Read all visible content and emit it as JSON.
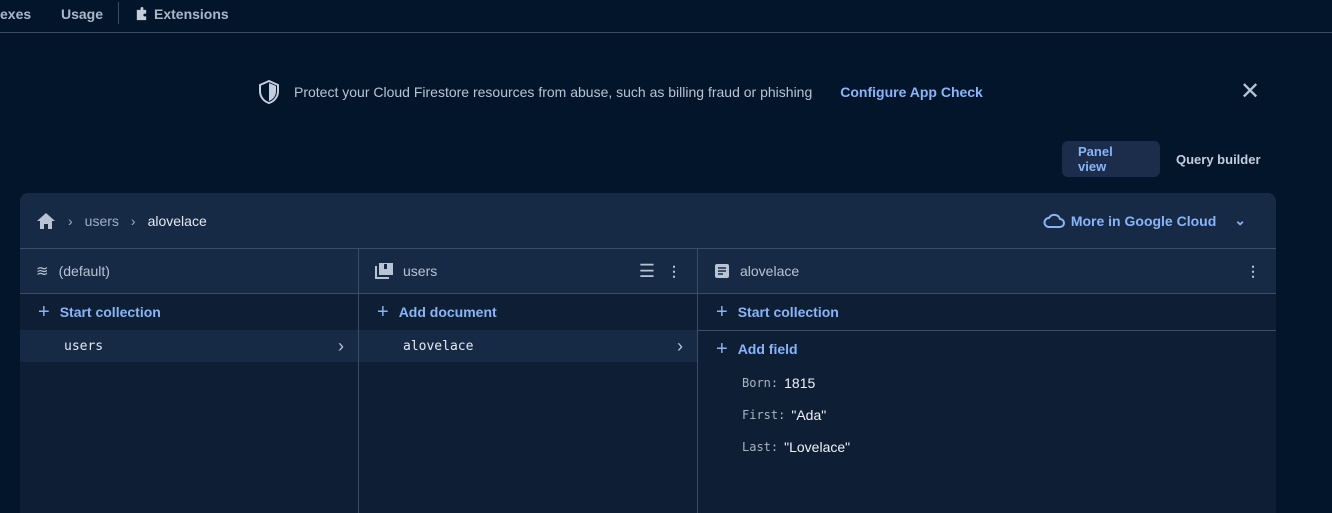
{
  "nav": {
    "items": [
      "exes",
      "Usage",
      "Extensions"
    ]
  },
  "banner": {
    "text": "Protect your Cloud Firestore resources from abuse, such as billing fraud or phishing",
    "link": "Configure App Check"
  },
  "view_toggle": {
    "panel": "Panel view",
    "query": "Query builder",
    "selected": "Panel view"
  },
  "breadcrumb": [
    "users",
    "alovelace"
  ],
  "more_cloud": "More in Google Cloud",
  "columns": [
    {
      "title": "(default)",
      "action": "Start collection",
      "selected": "users"
    },
    {
      "title": "users",
      "action": "Add document",
      "selected": "alovelace"
    },
    {
      "title": "alovelace",
      "action": "Start collection",
      "action2": "Add field",
      "fields": [
        {
          "key": "Born:",
          "value": "1815"
        },
        {
          "key": "First:",
          "value": "\"Ada\""
        },
        {
          "key": "Last:",
          "value": "\"Lovelace\""
        }
      ]
    }
  ],
  "colors": {
    "accent": "#8ab4f8",
    "background": "#03152a",
    "panel": "#172a45"
  }
}
